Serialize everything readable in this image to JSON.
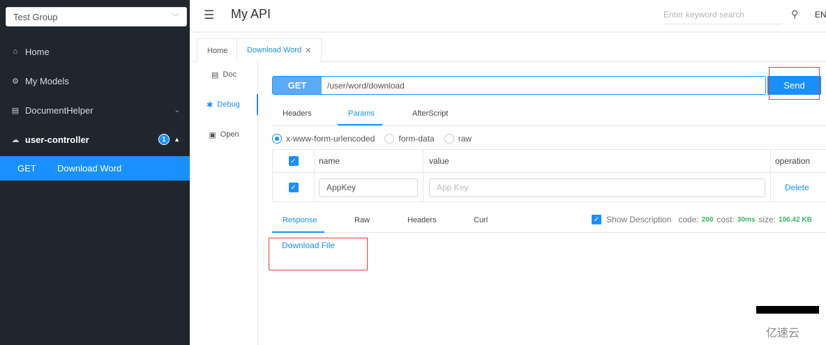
{
  "sidebar": {
    "group_select": {
      "value": "Test Group"
    },
    "items": [
      {
        "label": "Home",
        "icon": "home-icon"
      },
      {
        "label": "My Models",
        "icon": "models-icon"
      },
      {
        "label": "DocumentHelper",
        "icon": "document-helper-icon"
      },
      {
        "label": "user-controller",
        "icon": "controller-icon",
        "badge": "1"
      }
    ],
    "active_item": {
      "method": "GET",
      "title": "Download Word"
    }
  },
  "header": {
    "title": "My API",
    "search_placeholder": "Enter keyword search",
    "lang": "EN"
  },
  "tabs": [
    {
      "label": "Home"
    },
    {
      "label": "Download Word"
    }
  ],
  "doc_nav": [
    {
      "label": "Doc",
      "icon": "doc-icon"
    },
    {
      "label": "Debug",
      "icon": "bug-icon"
    },
    {
      "label": "Open",
      "icon": "open-icon"
    }
  ],
  "request": {
    "method": "GET",
    "url": "/user/word/download",
    "send_label": "Send",
    "tabs": [
      "Headers",
      "Params",
      "AfterScript"
    ],
    "active_tab": "Params",
    "body_types": [
      "x-www-form-urlencoded",
      "form-data",
      "raw"
    ],
    "selected_body_type": "x-www-form-urlencoded"
  },
  "params_table": {
    "headers": [
      "name",
      "value",
      "operation"
    ],
    "rows": [
      {
        "checked": true,
        "name": "AppKey",
        "value_placeholder": "App Key",
        "operation": "Delete"
      }
    ]
  },
  "response": {
    "tabs": [
      "Response",
      "Raw",
      "Headers",
      "Curl"
    ],
    "active_tab": "Response",
    "show_description_label": "Show Description",
    "show_description_checked": true,
    "code_label": "code:",
    "code": "200",
    "cost_label": "cost:",
    "cost": "30ms",
    "size_label": "size:",
    "size": "106.42 KB",
    "download_link": "Download File"
  },
  "watermark": "亿速云",
  "colors": {
    "accent": "#1890ff",
    "sidebar_bg": "#1f262d",
    "success": "#3bb36b",
    "highlight": "#e63b3b"
  }
}
